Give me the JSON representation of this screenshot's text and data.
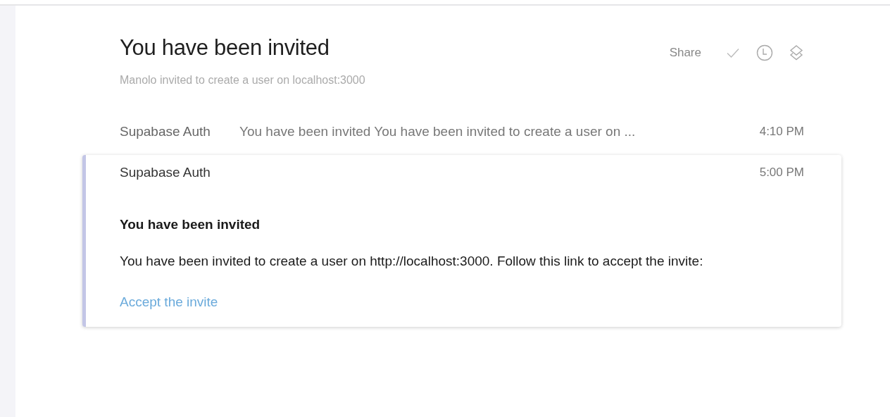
{
  "thread": {
    "title": "You have been invited",
    "subtitle": "Manolo invited to create a user on localhost:3000"
  },
  "toolbar": {
    "share": "Share"
  },
  "messages": [
    {
      "sender": "Supabase Auth",
      "snippet": "You have been invited You have been invited to create a user on ...",
      "time": "4:10 PM",
      "expanded": false
    },
    {
      "sender": "Supabase Auth",
      "time": "5:00 PM",
      "expanded": true,
      "heading": "You have been invited",
      "body": "You have been invited to create a user on http://localhost:3000. Follow this link to accept the invite:",
      "link": "Accept the invite"
    }
  ]
}
